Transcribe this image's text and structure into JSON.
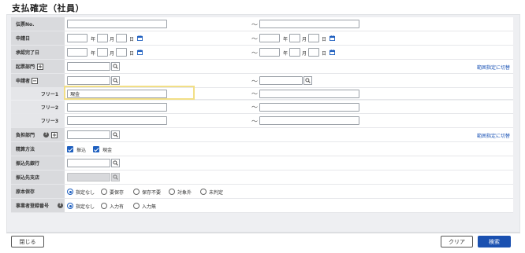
{
  "title": "支払確定（社員）",
  "rows": {
    "denpyo": {
      "label": "伝票No.",
      "to_sep": "～"
    },
    "shinseibi": {
      "label": "申請日",
      "y": "年",
      "m": "月",
      "d": "日",
      "to_sep": "～"
    },
    "shonin": {
      "label": "承認完了日",
      "y": "年",
      "m": "月",
      "d": "日",
      "to_sep": "～"
    },
    "kihyo": {
      "label": "起票部門",
      "toggle": "+",
      "link": "範囲指定に切替"
    },
    "shinseisha": {
      "label": "申請者",
      "toggle": "−",
      "to_sep": "～"
    },
    "free1": {
      "label": "フリー1",
      "value": "現金",
      "to_sep": "～"
    },
    "free2": {
      "label": "フリー2",
      "to_sep": "～"
    },
    "free3": {
      "label": "フリー3",
      "to_sep": "～"
    },
    "futan": {
      "label": "負担部門",
      "help": "?",
      "toggle": "+",
      "link": "範囲指定に切替"
    },
    "seisan": {
      "label": "精算方法",
      "options": [
        "振込",
        "現金"
      ]
    },
    "furikomi_ginko": {
      "label": "振込先銀行"
    },
    "furikomi_shiten": {
      "label": "振込先支店"
    },
    "genpon": {
      "label": "原本保存",
      "options": [
        "指定なし",
        "要保存",
        "保存不要",
        "対象外",
        "未判定"
      ],
      "selected": "指定なし"
    },
    "jigyosha": {
      "label": "事業者登録番号",
      "help": "?",
      "options": [
        "指定なし",
        "入力有",
        "入力無"
      ],
      "selected": "指定なし"
    }
  },
  "buttons": {
    "close": "閉じる",
    "clear": "クリア",
    "search": "検索"
  },
  "colors": {
    "accent": "#1a50b0",
    "highlight": "#f2df86",
    "link": "#1d55b6"
  },
  "icons": {
    "search": "search-icon",
    "calendar": "calendar-icon",
    "check": "checkbox-checked-icon"
  }
}
